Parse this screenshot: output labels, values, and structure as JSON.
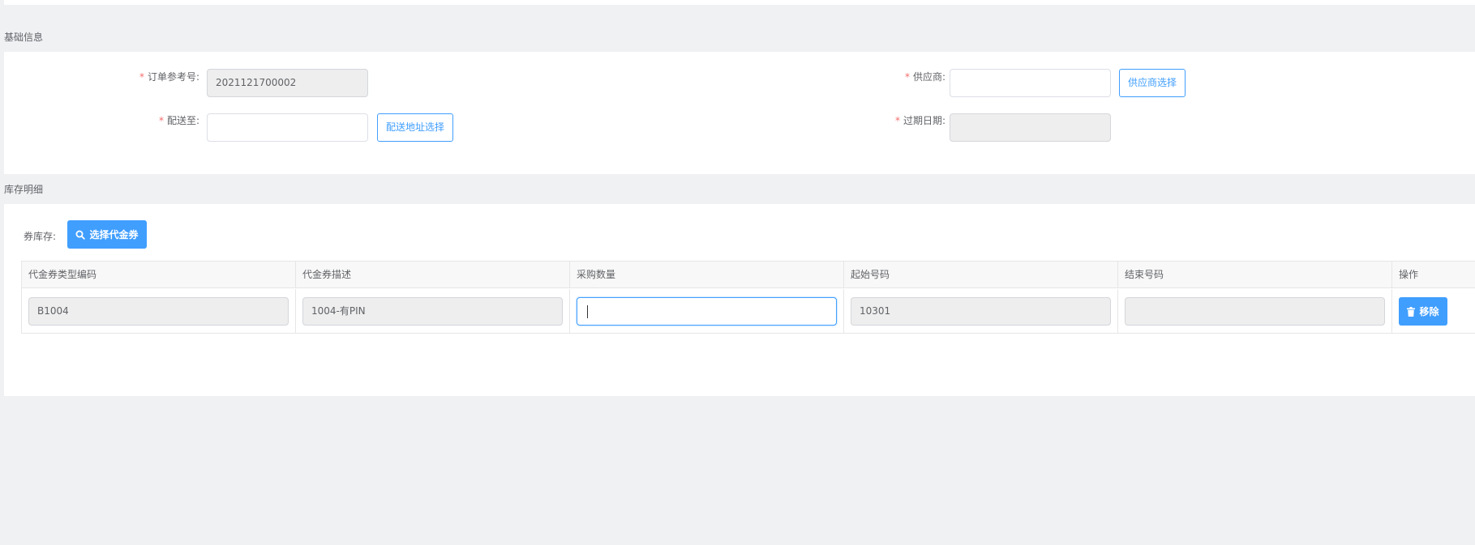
{
  "sections": {
    "basic_info": "基础信息",
    "inventory_detail": "库存明细"
  },
  "form": {
    "order_ref": {
      "label": "订单参考号:",
      "value": "2021121700002",
      "required": true
    },
    "supplier": {
      "label": "供应商:",
      "value": "",
      "required": true,
      "button": "供应商选择"
    },
    "ship_to": {
      "label": "配送至:",
      "value": "",
      "required": true,
      "button": "配送地址选择"
    },
    "expiry_date": {
      "label": "过期日期:",
      "value": "",
      "required": true
    }
  },
  "inventory": {
    "label": "券库存:",
    "select_button": "选择代金券",
    "columns": [
      "代金券类型编码",
      "代金券描述",
      "采购数量",
      "起始号码",
      "结束号码",
      "操作"
    ],
    "rows": [
      {
        "type_code": "B1004",
        "description": "1004-有PIN",
        "quantity": "",
        "start_no": "10301",
        "end_no": "",
        "remove_button": "移除"
      }
    ]
  },
  "colors": {
    "primary": "#409eff",
    "required": "#f56c6c",
    "background": "#f0f1f3"
  },
  "icons": {
    "search": "search-icon",
    "trash": "trash-icon"
  }
}
